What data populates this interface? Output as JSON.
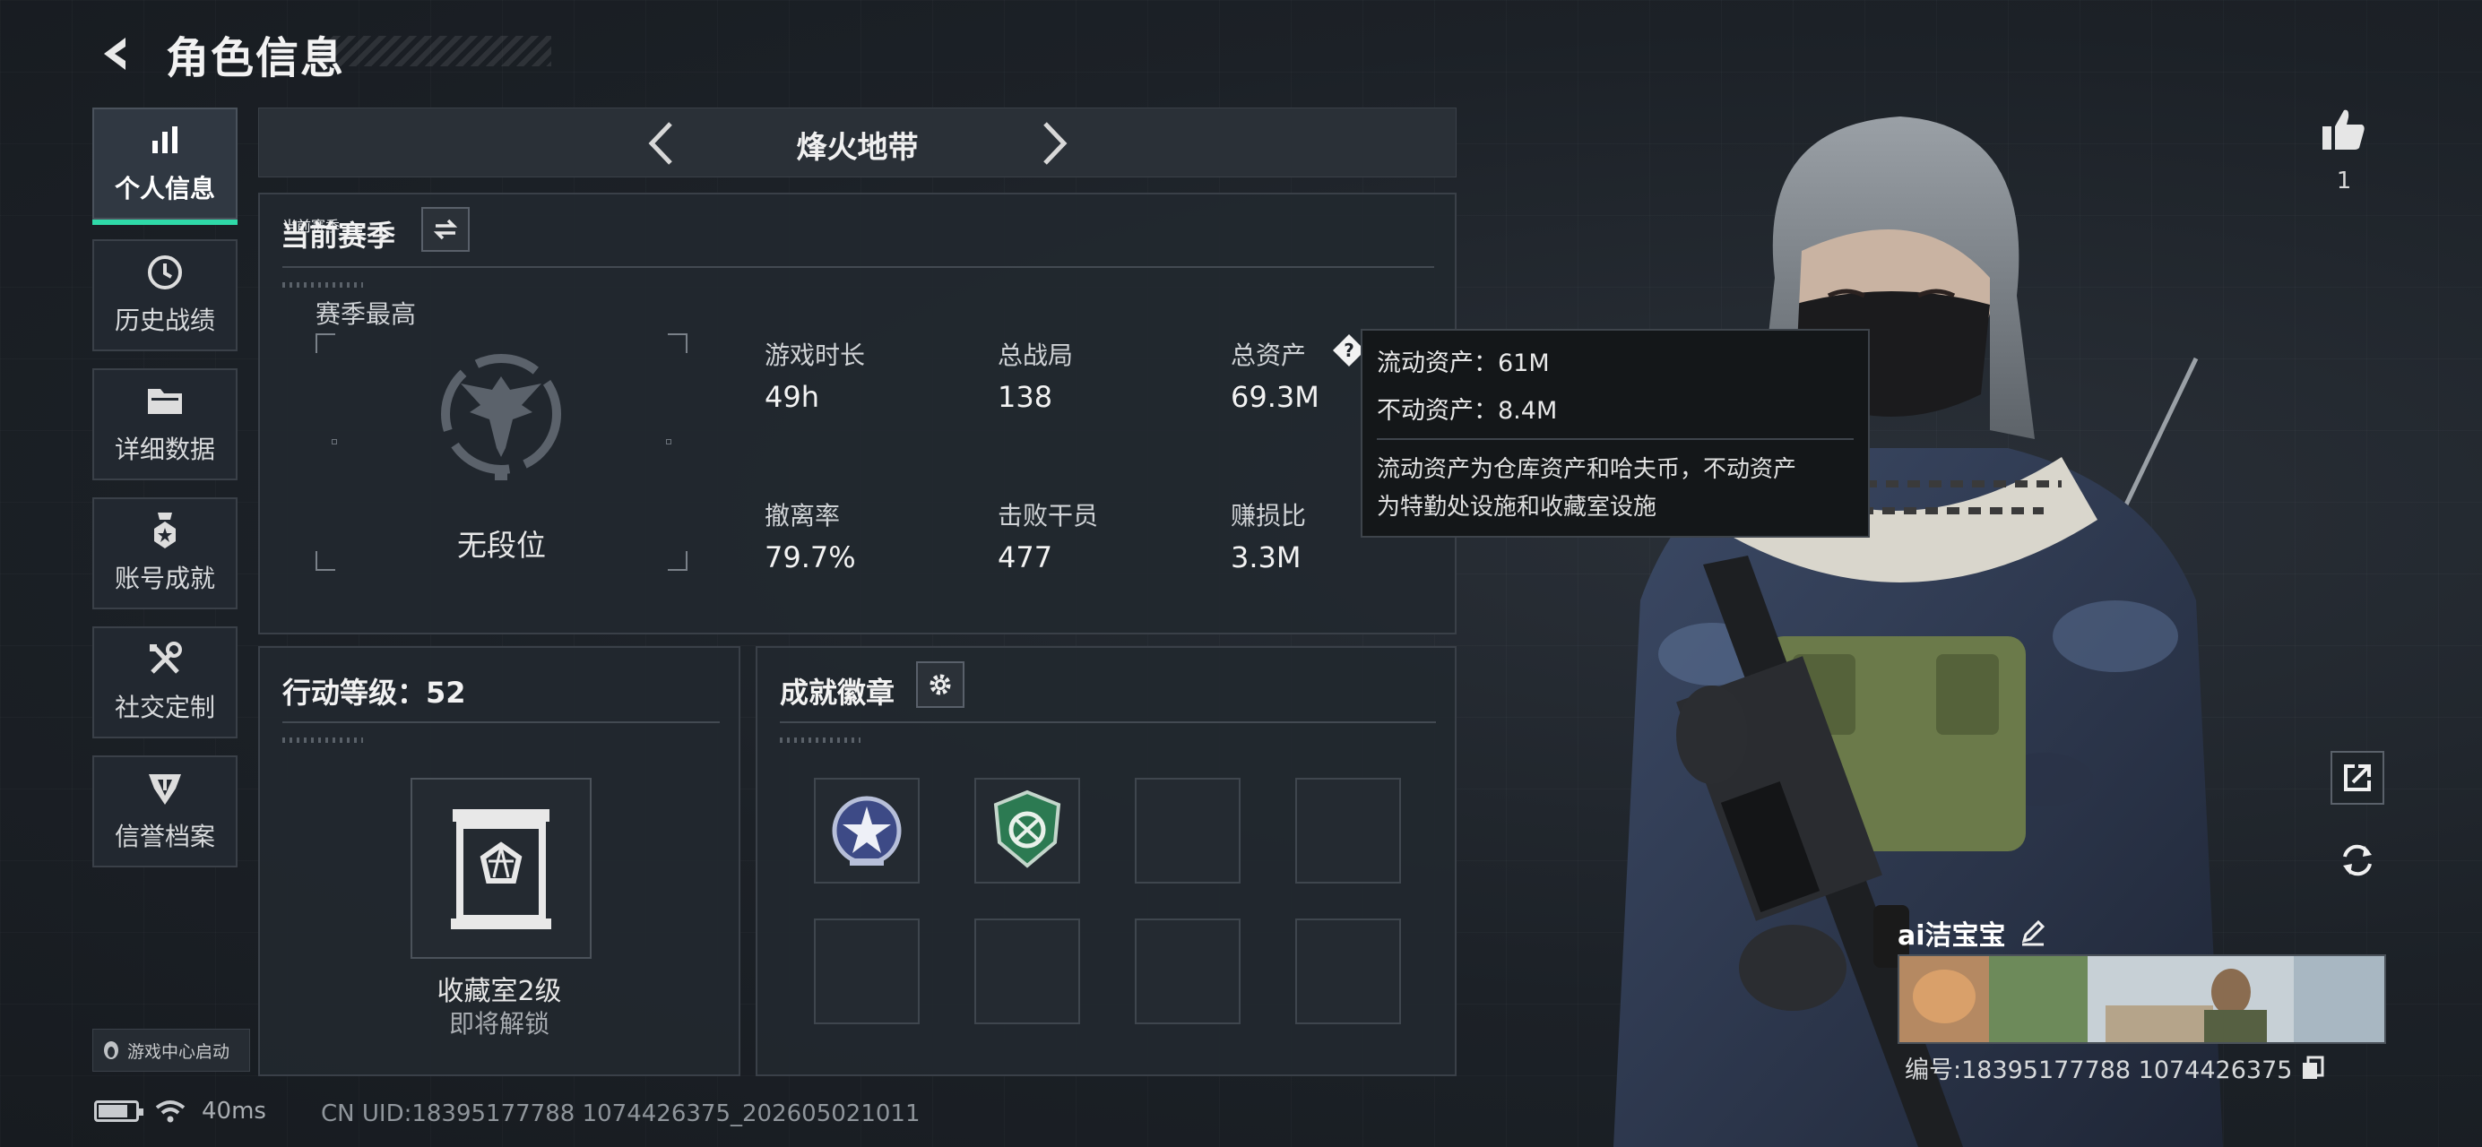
{
  "header": {
    "title": "角色信息",
    "back_icon": "chevron-left-icon"
  },
  "sidebar": {
    "items": [
      {
        "label": "个人信息",
        "icon": "bar-chart-icon",
        "active": true
      },
      {
        "label": "历史战绩",
        "icon": "clock-icon",
        "active": false
      },
      {
        "label": "详细数据",
        "icon": "folder-icon",
        "active": false
      },
      {
        "label": "账号成就",
        "icon": "medal-icon",
        "active": false
      },
      {
        "label": "社交定制",
        "icon": "tools-icon",
        "active": false
      },
      {
        "label": "信誉档案",
        "icon": "shield-icon",
        "active": false
      }
    ],
    "game_center": "游戏中心启动"
  },
  "mode": {
    "name": "烽火地带"
  },
  "season": {
    "title": "当前赛季",
    "best_label": "赛季最高",
    "rank": "无段位",
    "stats": [
      {
        "label": "游戏时长",
        "value": "49h"
      },
      {
        "label": "总战局",
        "value": "138"
      },
      {
        "label": "总资产",
        "value": "69.3M"
      },
      {
        "label": "撤离率",
        "value": "79.7%"
      },
      {
        "label": "击败干员",
        "value": "477"
      },
      {
        "label": "赚损比",
        "value": "3.3M"
      }
    ]
  },
  "tooltip": {
    "liquid": "流动资产：61M",
    "fixed": "不动资产：8.4M",
    "desc_line1": "流动资产为仓库资产和哈夫币，不动资产",
    "desc_line2": "为特勤处设施和收藏室设施"
  },
  "level": {
    "title": "行动等级：52",
    "collection_name": "收藏室2级",
    "collection_status": "即将解锁"
  },
  "badges": {
    "title": "成就徽章"
  },
  "status_bar": {
    "ping": "40ms",
    "uid": "CN UID:18395177788 1074426375_202605021011"
  },
  "profile": {
    "likes": "1",
    "player_name": "ai洁宝宝",
    "player_id": "编号:18395177788 1074426375"
  },
  "colors": {
    "accent": "#2fd9a8",
    "panel": "#22282f",
    "border": "#3a4048"
  }
}
